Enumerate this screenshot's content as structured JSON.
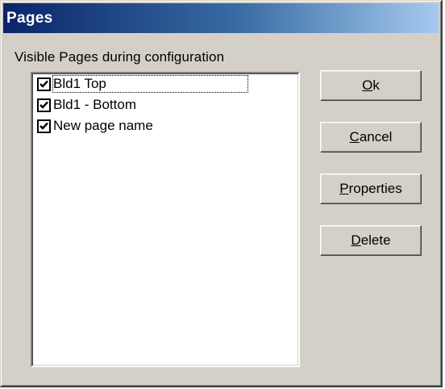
{
  "window": {
    "title": "Pages"
  },
  "group_label": "Visible Pages during configuration",
  "pages": [
    {
      "label": "Bld1 Top",
      "checked": true,
      "focused": true
    },
    {
      "label": "Bld1 - Bottom",
      "checked": true,
      "focused": false
    },
    {
      "label": "New page name",
      "checked": true,
      "focused": false
    }
  ],
  "buttons": {
    "ok": {
      "mnemonic": "O",
      "rest": "k"
    },
    "cancel": {
      "mnemonic": "C",
      "rest": "ancel"
    },
    "properties": {
      "mnemonic": "P",
      "rest": "roperties"
    },
    "delete": {
      "mnemonic": "D",
      "rest": "elete"
    }
  },
  "colors": {
    "title_start": "#0a246a",
    "title_end": "#a6caf0",
    "face": "#d4d0c8"
  }
}
